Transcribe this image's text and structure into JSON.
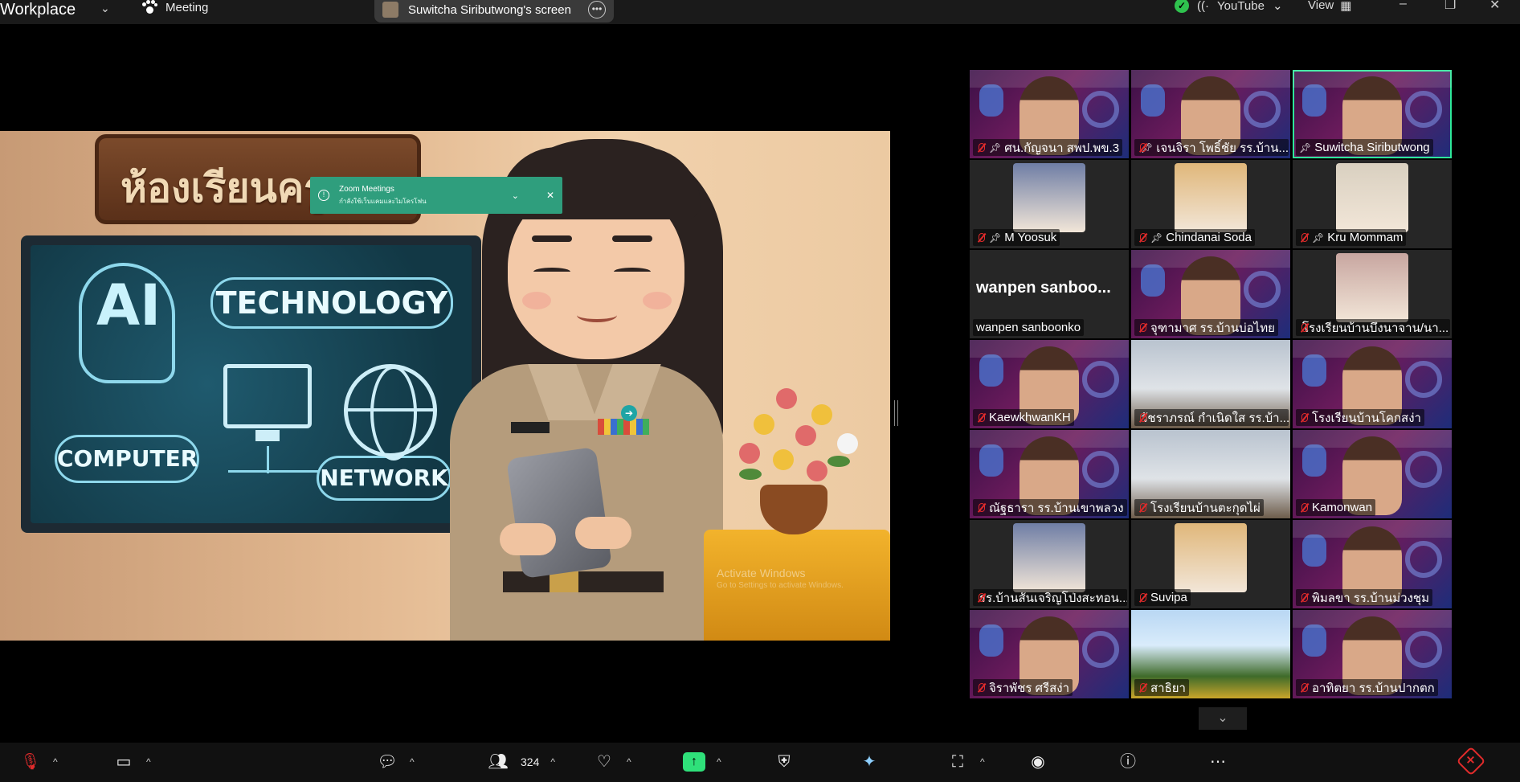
{
  "header": {
    "app_title": "Workplace",
    "meeting_label": "Meeting",
    "share_label": "Suwitcha Siributwong's screen",
    "stream_label": "YouTube",
    "view_label": "View"
  },
  "toast": {
    "title": "Zoom Meetings",
    "message": "กำลังใช้เว็บแคมและไมโครโฟน"
  },
  "slide": {
    "sign_text": "ห้องเรียนครูยาน",
    "words": {
      "ai": "AI",
      "technology": "TECHNOLOGY",
      "computer": "COMPUTER",
      "network": "NETWORK"
    },
    "watermark_title": "Activate Windows",
    "watermark_sub": "Go to Settings to activate Windows."
  },
  "participants": [
    {
      "name": "ศน.กัญจนา สพป.พข.3",
      "type": "video",
      "pinned": true,
      "muted": true
    },
    {
      "name": "เจนจิรา โพธิ์ชัย รร.บ้าน...",
      "type": "video",
      "pinned": true,
      "muted": true
    },
    {
      "name": "Suwitcha Siributwong",
      "type": "video",
      "pinned": true,
      "muted": false,
      "active": true
    },
    {
      "name": "M Yoosuk",
      "type": "avatar",
      "pinned": true,
      "muted": true
    },
    {
      "name": "Chindanai Soda",
      "type": "avatar",
      "pinned": true,
      "muted": true
    },
    {
      "name": "Kru Mommam",
      "type": "avatar",
      "pinned": true,
      "muted": true
    },
    {
      "name": "wanpen sanboonko",
      "type": "name",
      "big_name": "wanpen sanboo...",
      "muted": false
    },
    {
      "name": "จุฑามาศ รร.บ้านบ่อไทย",
      "type": "video",
      "muted": true
    },
    {
      "name": "โรงเรียนบ้านบึงนาจาน/นา...",
      "type": "avatar",
      "muted": true
    },
    {
      "name": "KaewkhwanKH",
      "type": "video",
      "muted": true
    },
    {
      "name": "วัชราภรณ์ กำเนิดใส รร.บ้า...",
      "type": "room",
      "muted": true
    },
    {
      "name": "โรงเรียนบ้านโคกสง่า",
      "type": "video",
      "muted": true
    },
    {
      "name": "ณัฐธารา รร.บ้านเขาพลวง",
      "type": "video",
      "muted": true
    },
    {
      "name": "โรงเรียนบ้านตะกุดไผ่",
      "type": "room",
      "muted": true
    },
    {
      "name": "Kamonwan",
      "type": "video",
      "muted": true
    },
    {
      "name": "รร.บ้านสันเจริญโป่งสะทอน...",
      "type": "avatar",
      "muted": true
    },
    {
      "name": "Suvipa",
      "type": "avatar",
      "muted": true
    },
    {
      "name": "พิมลขา รร.บ้านม่วงชุม",
      "type": "video",
      "muted": true
    },
    {
      "name": "จิราพัชร ศรีสง่า",
      "type": "video",
      "muted": true
    },
    {
      "name": "สาธิยา",
      "type": "sky",
      "muted": true
    },
    {
      "name": "อาทิตยา รร.บ้านปากตก",
      "type": "video",
      "muted": true
    }
  ],
  "toolbar": {
    "participant_count": "324"
  },
  "icons": [
    "mic-muted-icon",
    "camera-icon",
    "chat-icon",
    "participants-icon",
    "reactions-icon",
    "share-screen-icon",
    "security-icon",
    "ai-companion-icon",
    "apps-icon",
    "record-icon",
    "info-icon",
    "more-icon",
    "leave-icon"
  ],
  "colors": {
    "accent_green": "#2fe07a",
    "active_border": "#2ee89a",
    "toast_bg": "#2f9e7d",
    "leave_red": "#e02b2b"
  }
}
